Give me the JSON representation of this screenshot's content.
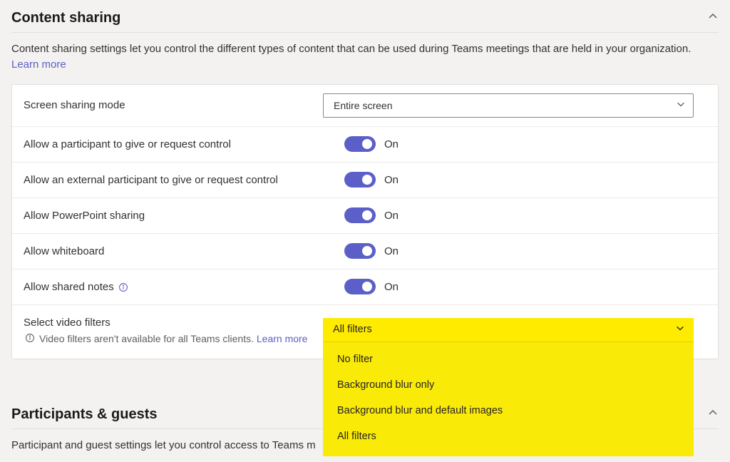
{
  "section1": {
    "title": "Content sharing",
    "description": "Content sharing settings let you control the different types of content that can be used during Teams meetings that are held in your organization.",
    "learn_more": "Learn more"
  },
  "rows": {
    "screen_sharing": {
      "label": "Screen sharing mode",
      "value": "Entire screen"
    },
    "participant_control": {
      "label": "Allow a participant to give or request control",
      "state": "On"
    },
    "external_control": {
      "label": "Allow an external participant to give or request control",
      "state": "On"
    },
    "ppt_sharing": {
      "label": "Allow PowerPoint sharing",
      "state": "On"
    },
    "whiteboard": {
      "label": "Allow whiteboard",
      "state": "On"
    },
    "shared_notes": {
      "label": "Allow shared notes",
      "state": "On"
    },
    "video_filters": {
      "label": "Select video filters",
      "hint_prefix": "Video filters aren't available for all Teams clients. ",
      "hint_link": "Learn more",
      "selected": "All filters",
      "options": {
        "o1": "No filter",
        "o2": "Background blur only",
        "o3": "Background blur and default images",
        "o4": "All filters"
      }
    }
  },
  "section2": {
    "title": "Participants & guests",
    "description": "Participant and guest settings let you control access to Teams m"
  }
}
